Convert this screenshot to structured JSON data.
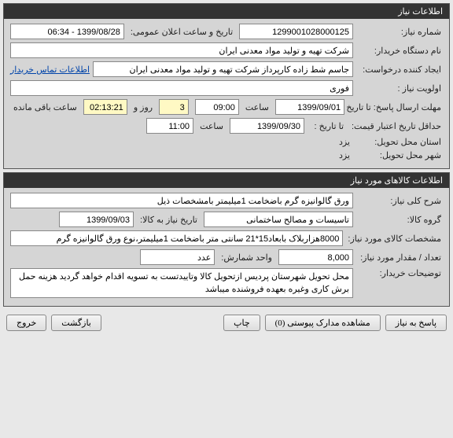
{
  "sections": {
    "need_info_title": "اطلاعات نیاز",
    "goods_info_title": "اطلاعات کالاهای مورد نیاز"
  },
  "labels": {
    "need_number": "شماره نیاز:",
    "public_announce": "تاریخ و ساعت اعلان عمومی:",
    "org_name": "نام دستگاه خریدار:",
    "request_creator": "ایجاد کننده درخواست:",
    "need_priority": "اولویت نیاز :",
    "deadline": "مهلت ارسال پاسخ:  تا تاریخ :",
    "time": "ساعت",
    "days": "روز و",
    "time_remain": "ساعت باقی مانده",
    "min_validity": "حداقل تاریخ اعتبار قیمت:",
    "until_date": "تا تاریخ :",
    "delivery_province": "استان محل تحویل:",
    "delivery_city": "شهر محل تحویل:",
    "yazd": "یزد",
    "general_desc": "شرح کلی نیاز:",
    "goods_group": "گروه کالا:",
    "need_date": "تاریخ نیاز به کالا:",
    "goods_spec": "مشخصات کالای مورد نیاز:",
    "qty": "تعداد / مقدار مورد نیاز:",
    "unit": "واحد شمارش:",
    "buyer_notes": "توضیحات خریدار:",
    "contact_link": "اطلاعات تماس خریدار"
  },
  "values": {
    "need_number": "1299001028000125",
    "announce_datetime": "1399/08/28 - 06:34",
    "org_name": "شرکت تهیه و تولید مواد معدنی ایران",
    "request_creator": "جاسم شط زاده کارپرداز شرکت تهیه و تولید مواد معدنی ایران",
    "priority": "فوری",
    "deadline_date": "1399/09/01",
    "deadline_time": "09:00",
    "remain_days": "3",
    "remain_time": "02:13:21",
    "validity_date": "1399/09/30",
    "validity_time": "11:00",
    "province": "یزد",
    "city": "یزد",
    "general_desc": "ورق گالوانیزه گرم باضخامت 1میلیمتر بامشخصات ذیل",
    "goods_group": "تاسیسات و مصالح ساختمانی",
    "need_date": "1399/09/03",
    "goods_spec": "8000هزاربلاک بابعاد15*21 سانتی متر باضخامت 1میلیمتر،نوع ورق گالوانیزه گرم",
    "qty": "8,000",
    "unit": "عدد",
    "buyer_notes": "محل تحویل شهرستان پردیس ازتحویل کالا وتاییدتست به تسویه اقدام خواهد گردید هزینه حمل برش کاری وغیره بعهده فروشنده میباشد"
  },
  "buttons": {
    "respond": "پاسخ به نیاز",
    "attachments": "مشاهده مدارک پیوستی (0)",
    "print": "چاپ",
    "back": "بازگشت",
    "exit": "خروج"
  }
}
